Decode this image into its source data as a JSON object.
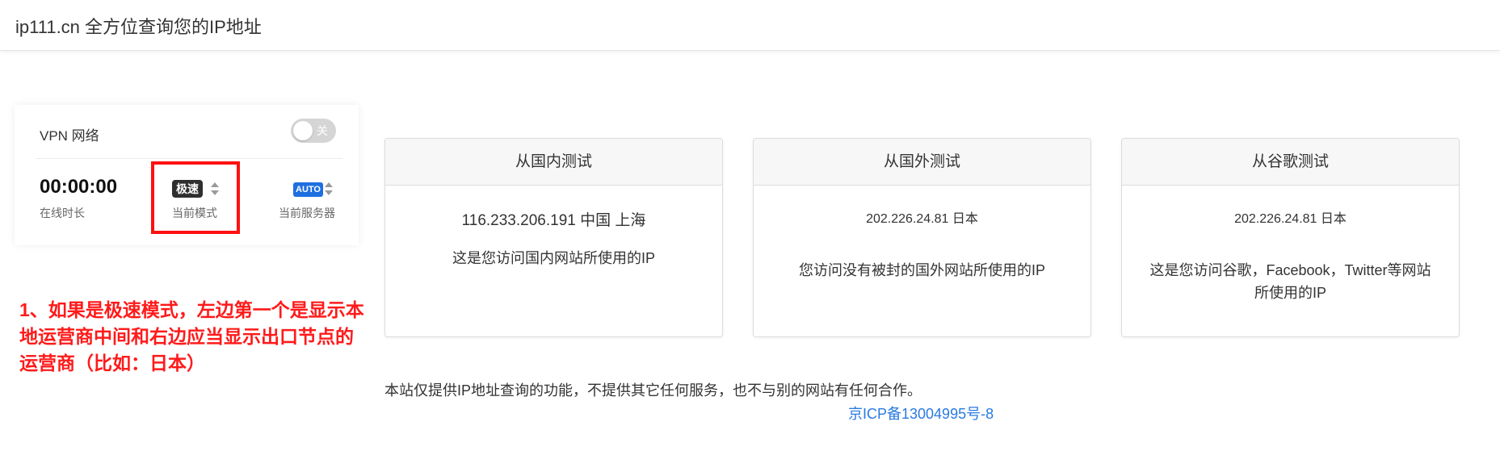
{
  "header": {
    "title": "ip111.cn 全方位查询您的IP地址"
  },
  "vpn": {
    "title": "VPN 网络",
    "toggle_text": "关",
    "online_time": "00:00:00",
    "online_time_label": "在线时长",
    "mode_badge": "极速",
    "mode_label": "当前模式",
    "server_badge": "AUTO",
    "server_label": "当前服务器"
  },
  "annotation": {
    "text": "1、如果是极速模式，左边第一个是显示本地运营商中间和右边应当显示出口节点的运营商（比如：日本）"
  },
  "cards": [
    {
      "title": "从国内测试",
      "ip_line": "116.233.206.191 中国 上海",
      "desc": "这是您访问国内网站所使用的IP"
    },
    {
      "title": "从国外测试",
      "ip_line": "202.226.24.81 日本",
      "desc": "您访问没有被封的国外网站所使用的IP"
    },
    {
      "title": "从谷歌测试",
      "ip_line": "202.226.24.81 日本",
      "desc_line1": "这是您访问谷歌，Facebook，Twitter等网站",
      "desc_line2": "所使用的IP"
    }
  ],
  "footer": {
    "note": "本站仅提供IP地址查询的功能，不提供其它任何服务，也不与别的网站有任何合作。",
    "icp_link": "京ICP备13004995号-8"
  },
  "colors": {
    "annotation_red": "#ff1a1a",
    "link_blue": "#2a7ae2",
    "server_badge_blue": "#1e6fe0",
    "mode_badge_dark": "#2f2f2f"
  },
  "icons": {
    "mode_sort": "sort-updown-icon",
    "server_sort": "sort-updown-icon"
  }
}
